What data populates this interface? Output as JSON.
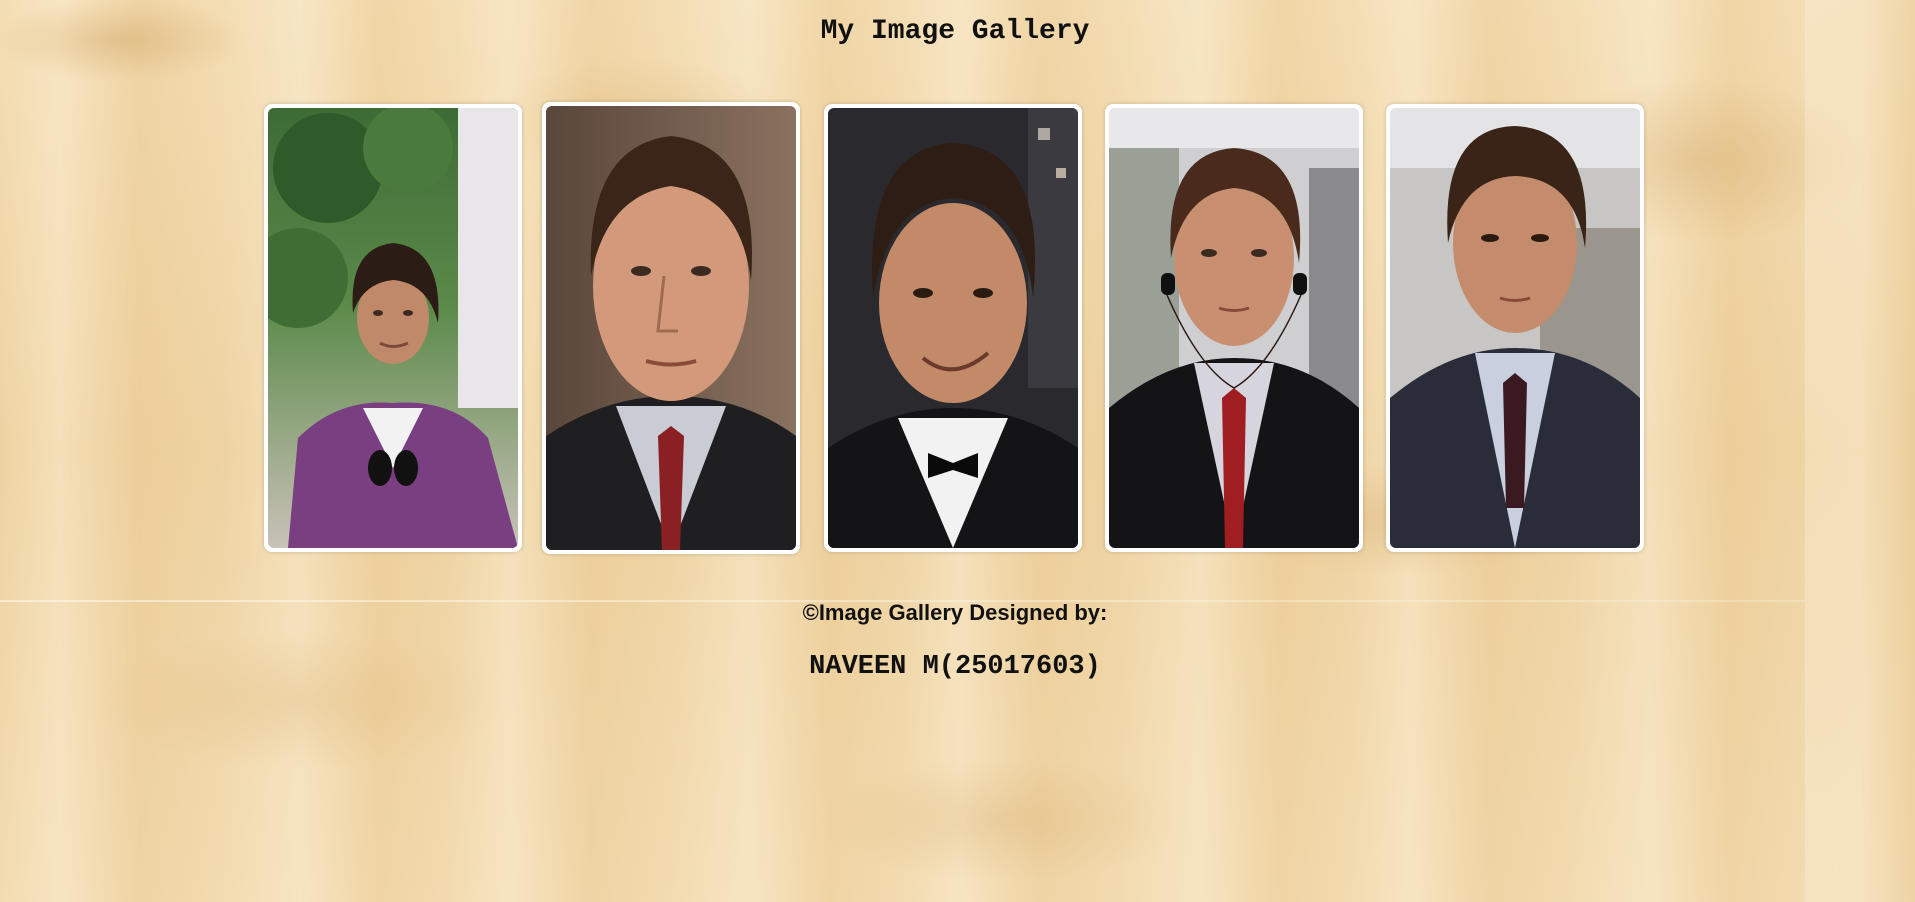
{
  "page": {
    "title": "My Image Gallery"
  },
  "gallery": {
    "images": [
      {
        "name": "photo-1",
        "subject": "man-in-purple-shirt-outdoors"
      },
      {
        "name": "photo-2",
        "subject": "man-in-suit-closeup"
      },
      {
        "name": "photo-3",
        "subject": "man-in-tuxedo-smiling"
      },
      {
        "name": "photo-4",
        "subject": "man-in-suit-with-headphones"
      },
      {
        "name": "photo-5",
        "subject": "man-in-pinstripe-suit"
      }
    ]
  },
  "footer": {
    "credit_label": "©Image Gallery Designed by:",
    "author": "NAVEEN M(25017603)"
  },
  "colors": {
    "background": "#f1d9ad",
    "card_border": "#ffffff",
    "text": "#111111"
  }
}
